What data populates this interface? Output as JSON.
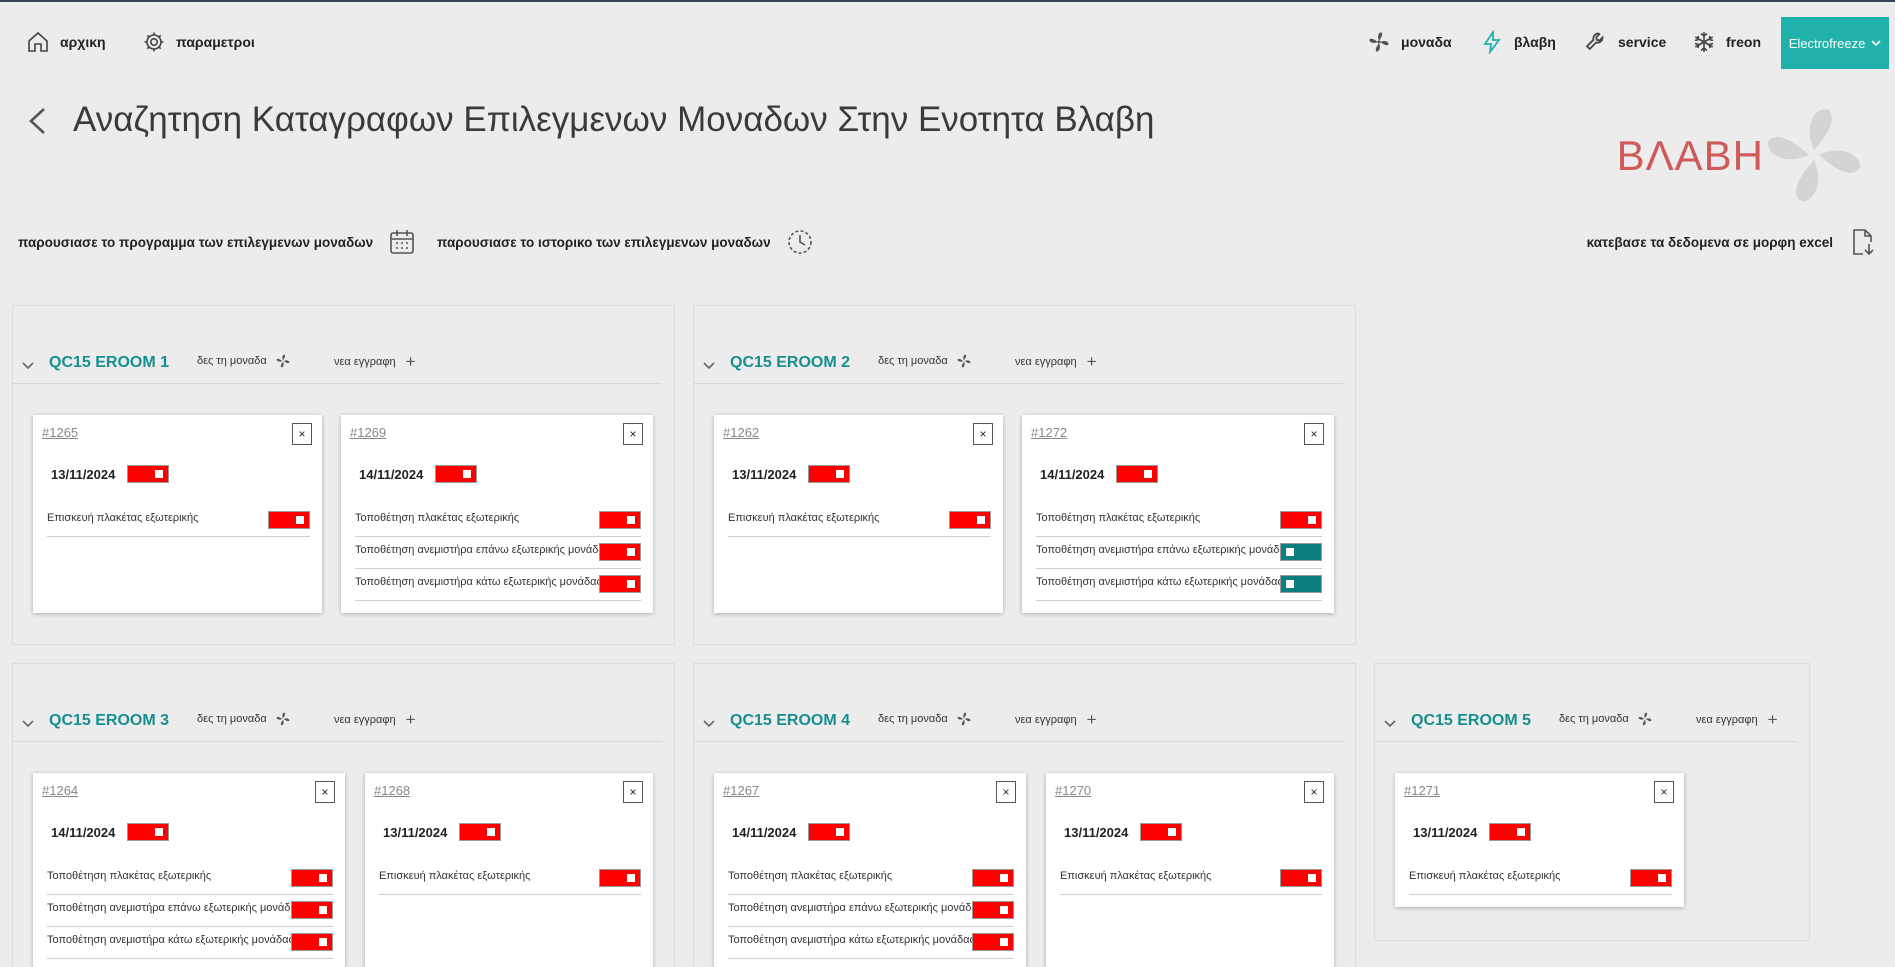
{
  "nav": {
    "home": "αρχικη",
    "settings": "παραμετροι",
    "unit": "μοναδα",
    "fault": "βλαβη",
    "service": "service",
    "freon": "freon",
    "brand": "Electrofreeze"
  },
  "page": {
    "title": "Αναζητηση Καταγραφων Επιλεγμενων Μοναδων Στην Ενοτητα Βλαβη",
    "section_badge": "ΒΛΑΒΗ"
  },
  "actions": {
    "schedule": "παρουσιασε το προγραμμα των επιλεγμενων μοναδων",
    "history": "παρουσιασε το ιστορικο των επιλεγμενων μοναδων",
    "excel": "κατεβασε τα δεδομενα σε μορφη excel"
  },
  "labels": {
    "see_unit": "δες τη μοναδα",
    "new_entry": "νεα εγγραφη",
    "close": "×"
  },
  "colors": {
    "accent": "#20b2aa",
    "unit_name": "#178f8f",
    "toggle_on": "#ff0000",
    "toggle_off": "#0c8080",
    "badge": "#d05a5a"
  },
  "units": [
    {
      "name": "QC15 EROOM 1",
      "records": [
        {
          "id": "#1265",
          "date": "13/11/2024",
          "active": true,
          "tasks": [
            {
              "label": "Επισκευή πλακέτας εξωτερικής",
              "active": true
            }
          ]
        },
        {
          "id": "#1269",
          "date": "14/11/2024",
          "active": true,
          "tasks": [
            {
              "label": "Τοποθέτηση πλακέτας εξωτερικής",
              "active": true
            },
            {
              "label": "Τοποθέτηση ανεμιστήρα επάνω εξωτερικής μονάδας",
              "active": true
            },
            {
              "label": "Τοποθέτηση ανεμιστήρα κάτω εξωτερικής μονάδας",
              "active": true
            }
          ]
        }
      ]
    },
    {
      "name": "QC15 EROOM 2",
      "records": [
        {
          "id": "#1262",
          "date": "13/11/2024",
          "active": true,
          "tasks": [
            {
              "label": "Επισκευή πλακέτας εξωτερικής",
              "active": true
            }
          ]
        },
        {
          "id": "#1272",
          "date": "14/11/2024",
          "active": true,
          "tasks": [
            {
              "label": "Τοποθέτηση πλακέτας εξωτερικής",
              "active": true
            },
            {
              "label": "Τοποθέτηση ανεμιστήρα επάνω εξωτερικής μονάδας",
              "active": false
            },
            {
              "label": "Τοποθέτηση ανεμιστήρα κάτω εξωτερικής μονάδας",
              "active": false
            }
          ]
        }
      ]
    },
    {
      "name": "QC15 EROOM 3",
      "records": [
        {
          "id": "#1264",
          "date": "14/11/2024",
          "active": true,
          "tasks": [
            {
              "label": "Τοποθέτηση πλακέτας εξωτερικής",
              "active": true
            },
            {
              "label": "Τοποθέτηση ανεμιστήρα επάνω εξωτερικής μονάδας",
              "active": true
            },
            {
              "label": "Τοποθέτηση ανεμιστήρα κάτω εξωτερικής μονάδας",
              "active": true
            }
          ]
        },
        {
          "id": "#1268",
          "date": "13/11/2024",
          "active": true,
          "tasks": [
            {
              "label": "Επισκευή πλακέτας εξωτερικής",
              "active": true
            }
          ]
        }
      ]
    },
    {
      "name": "QC15 EROOM 4",
      "records": [
        {
          "id": "#1267",
          "date": "14/11/2024",
          "active": true,
          "tasks": [
            {
              "label": "Τοποθέτηση πλακέτας εξωτερικής",
              "active": true
            },
            {
              "label": "Τοποθέτηση ανεμιστήρα επάνω εξωτερικής μονάδας",
              "active": true
            },
            {
              "label": "Τοποθέτηση ανεμιστήρα κάτω εξωτερικής μονάδας",
              "active": true
            }
          ]
        },
        {
          "id": "#1270",
          "date": "13/11/2024",
          "active": true,
          "tasks": [
            {
              "label": "Επισκευή πλακέτας εξωτερικής",
              "active": true
            }
          ]
        }
      ]
    },
    {
      "name": "QC15 EROOM 5",
      "records": [
        {
          "id": "#1271",
          "date": "13/11/2024",
          "active": true,
          "tasks": [
            {
              "label": "Επισκευή πλακέτας εξωτερικής",
              "active": true
            }
          ]
        }
      ]
    }
  ]
}
